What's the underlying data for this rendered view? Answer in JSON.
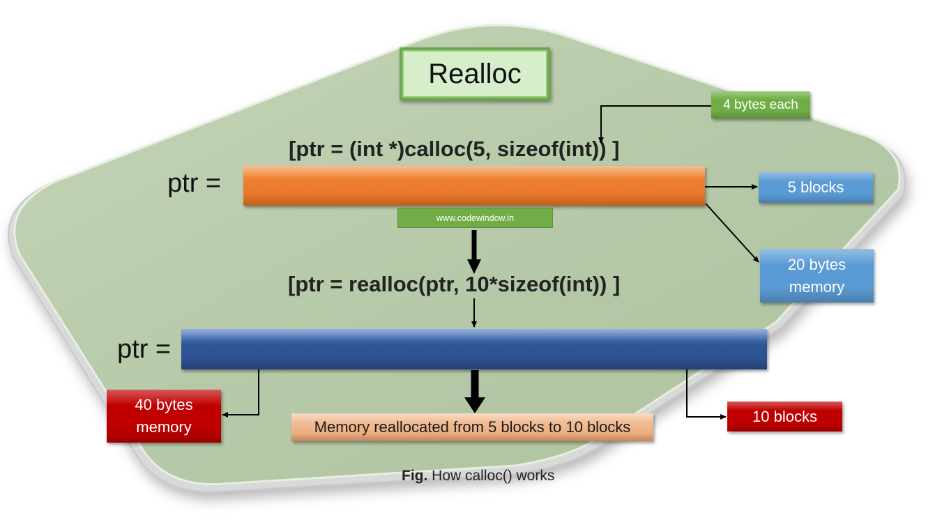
{
  "title": "Realloc",
  "calloc_statement": "[ptr = (int *)calloc(5, sizeof(int)) ]",
  "realloc_statement": "[ptr = realloc(ptr, 10*sizeof(int)) ]",
  "ptr_label": "ptr =",
  "watermark": "www.codewindow.in",
  "annotations": {
    "bytes_each": "4 bytes each",
    "five_blocks": "5 blocks",
    "twenty_bytes_line1": "20 bytes",
    "twenty_bytes_line2": "memory",
    "forty_bytes_line1": "40 bytes",
    "forty_bytes_line2": "memory",
    "ten_blocks": "10 blocks",
    "result": "Memory reallocated from 5 blocks to 10 blocks"
  },
  "caption": {
    "prefix": "Fig.",
    "text": " How calloc() works"
  },
  "colors": {
    "background_shape": "#b7cbaa",
    "title_fill": "#d7eecb",
    "title_border": "#6aa84f",
    "calloc_bar": "#ed7d31",
    "realloc_bar": "#2f5597",
    "blue_tag": "#5b9bd5",
    "green_tag": "#6fae45",
    "red_tag": "#c00000",
    "orange_tag": "#f0b48c"
  }
}
